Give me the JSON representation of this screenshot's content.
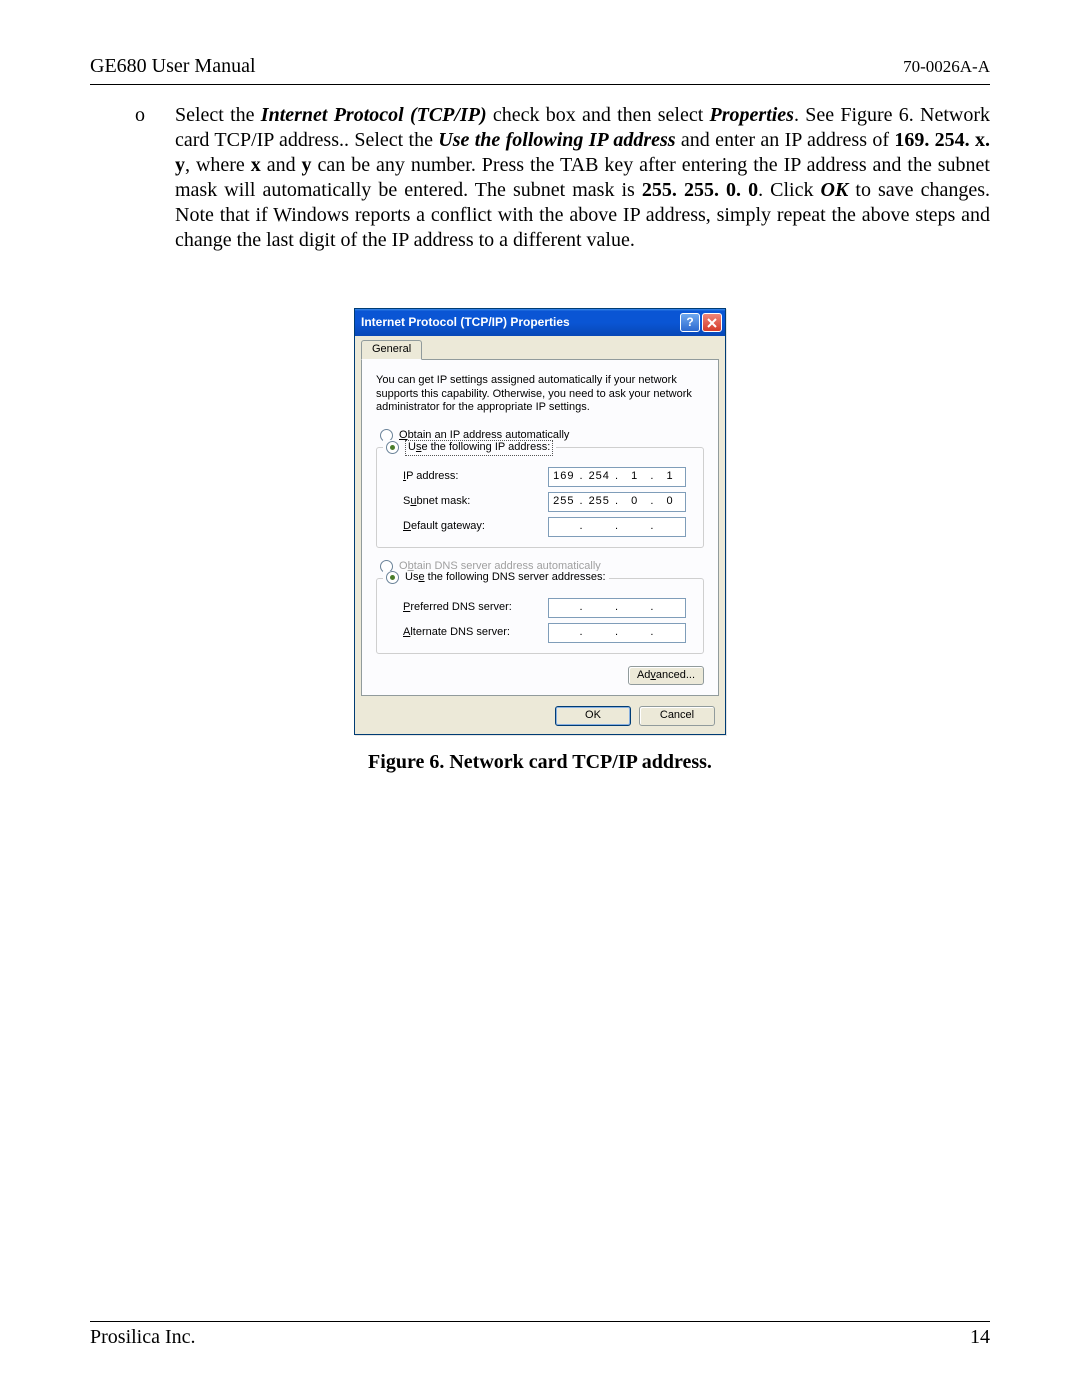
{
  "header": {
    "title": "GE680 User Manual",
    "doc_code": "70-0026A-A"
  },
  "body": {
    "bullet": "o",
    "text_parts": {
      "p1": "Select the ",
      "b1": "Internet Protocol (TCP/IP)",
      "p2": " check box and then select ",
      "b2": "Properties",
      "p3": ". See Figure 6. Network card TCP/IP address.. Select the ",
      "b3": "Use the following IP address",
      "p4": " and enter an IP address of ",
      "b4": "169. 254. x. y",
      "p5": ", where ",
      "b5": "x",
      "p6": " and ",
      "b6": "y",
      "p7": " can be any number. Press the TAB key after entering the IP address and the subnet mask will automatically be entered. The subnet mask is ",
      "b7": "255. 255. 0. 0",
      "p8": ".  Click ",
      "b8": "OK",
      "p9": " to save changes.  Note that if Windows reports a conflict with the above IP address, simply repeat the above steps and change the last digit of the IP address to a different value."
    }
  },
  "dialog": {
    "title": "Internet Protocol (TCP/IP) Properties",
    "help_glyph": "?",
    "tab": "General",
    "description": "You can get IP settings assigned automatically if your network supports this capability. Otherwise, you need to ask your network administrator for the appropriate IP settings.",
    "ip_section": {
      "radio_auto": {
        "u": "O",
        "rest": "btain an IP address automatically"
      },
      "radio_manual": {
        "pre": "U",
        "u": "s",
        "rest": "e the following IP address:"
      },
      "ip_label": {
        "u": "I",
        "rest": "P address:"
      },
      "subnet_label": {
        "pre": "S",
        "u": "u",
        "rest": "bnet mask:"
      },
      "gateway_label": {
        "u": "D",
        "rest": "efault gateway:"
      },
      "ip_value": [
        "169",
        "254",
        "1",
        "1"
      ],
      "subnet_value": [
        "255",
        "255",
        "0",
        "0"
      ],
      "gateway_value": [
        "",
        "",
        "",
        ""
      ]
    },
    "dns_section": {
      "radio_auto": {
        "pre": "O",
        "u": "b",
        "rest": "tain DNS server address automatically"
      },
      "radio_manual": {
        "pre": "Us",
        "u": "e",
        "rest": " the following DNS server addresses:"
      },
      "pref_label": {
        "u": "P",
        "rest": "referred DNS server:"
      },
      "alt_label": {
        "u": "A",
        "rest": "lternate DNS server:"
      },
      "pref_value": [
        "",
        "",
        "",
        ""
      ],
      "alt_value": [
        "",
        "",
        "",
        ""
      ]
    },
    "advanced": {
      "pre": "Ad",
      "u": "v",
      "rest": "anced..."
    },
    "ok": "OK",
    "cancel": "Cancel"
  },
  "caption": "Figure 6.  Network card TCP/IP address.",
  "footer": {
    "company": "Prosilica Inc.",
    "page": "14"
  }
}
